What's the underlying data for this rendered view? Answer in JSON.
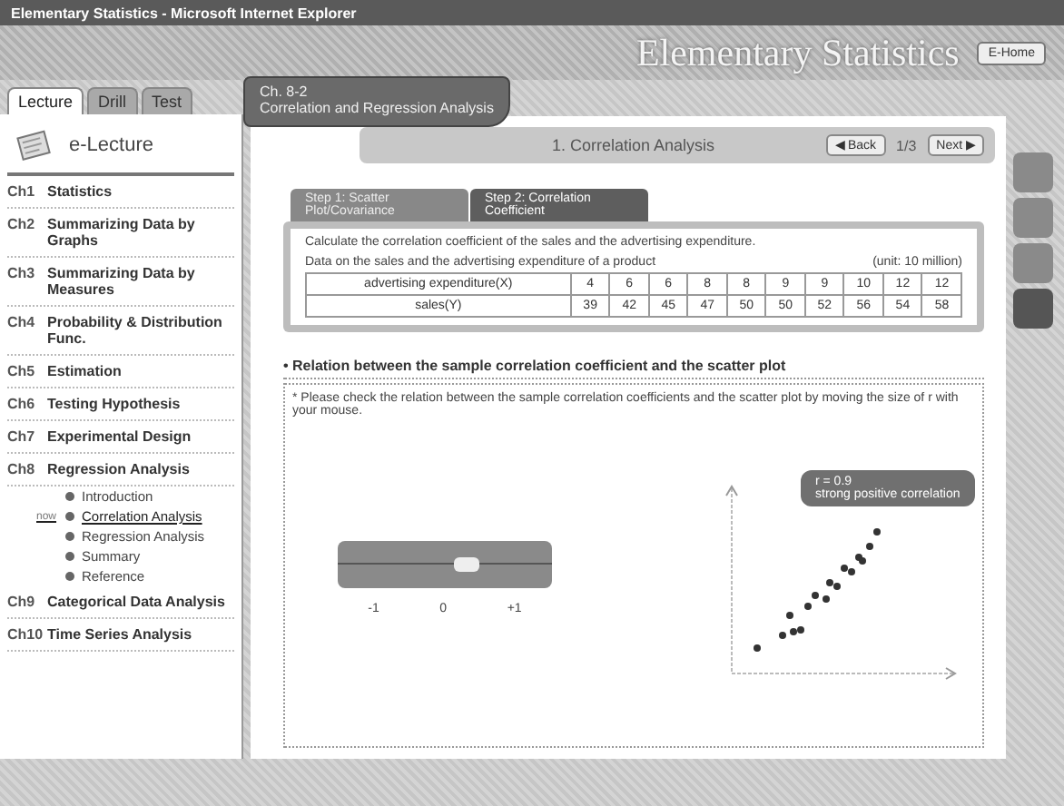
{
  "window": {
    "title": "Elementary Statistics - Microsoft Internet Explorer"
  },
  "header": {
    "title": "Elementary Statistics",
    "home_button": "E-Home"
  },
  "sidebar": {
    "tabs": [
      {
        "label": "Lecture",
        "selected": true
      },
      {
        "label": "Drill",
        "selected": false
      },
      {
        "label": "Test",
        "selected": false
      }
    ],
    "heading": "e-Lecture",
    "items": [
      {
        "number": "Ch1",
        "label": "Statistics"
      },
      {
        "number": "Ch2",
        "label": "Summarizing Data by Graphs"
      },
      {
        "number": "Ch3",
        "label": "Summarizing Data by Measures"
      },
      {
        "number": "Ch4",
        "label": "Probability & Distribution Func."
      },
      {
        "number": "Ch5",
        "label": "Estimation"
      },
      {
        "number": "Ch6",
        "label": "Testing Hypothesis"
      },
      {
        "number": "Ch7",
        "label": "Experimental Design"
      },
      {
        "number": "Ch8",
        "label": "Regression Analysis",
        "children": [
          {
            "label": "Introduction",
            "selected": false
          },
          {
            "label": "Correlation Analysis",
            "selected": true,
            "marker": "now"
          },
          {
            "label": "Regression Analysis",
            "selected": false
          },
          {
            "label": "Summary",
            "selected": false
          },
          {
            "label": "Reference",
            "selected": false
          }
        ]
      },
      {
        "number": "Ch9",
        "label": "Categorical Data Analysis"
      },
      {
        "number": "Ch10",
        "label": "Time Series Analysis"
      }
    ]
  },
  "chapter": {
    "number": "Ch. 8-2",
    "title": "Correlation and Regression Analysis"
  },
  "section_bar": {
    "title": "1. Correlation Analysis",
    "back": "◀ Back",
    "page": "1/3",
    "next": "Next ▶"
  },
  "steps": [
    {
      "label": "Step 1: Scatter Plot/Covariance",
      "selected": false
    },
    {
      "label": "Step 2: Correlation Coefficient",
      "selected": true
    }
  ],
  "exercise": {
    "instruction": "Calculate the correlation coefficient of the sales and the advertising expenditure.",
    "caption": "Data on the sales and the advertising expenditure of a product",
    "unit": "(unit: 10 million)",
    "rows": [
      {
        "label": "advertising expenditure(X)",
        "values": [
          "4",
          "6",
          "6",
          "8",
          "8",
          "9",
          "9",
          "10",
          "12",
          "12"
        ]
      },
      {
        "label": "sales(Y)",
        "values": [
          "39",
          "42",
          "45",
          "47",
          "50",
          "50",
          "52",
          "56",
          "54",
          "58"
        ]
      }
    ]
  },
  "relation": {
    "heading": "• Relation between the sample correlation coefficient and the scatter plot",
    "note": "* Please check the relation between the sample correlation coefficients and the scatter plot by moving the size of r with your mouse.",
    "slider": {
      "level": 0.6,
      "ticks": [
        "-1",
        "0",
        "+1"
      ]
    },
    "callout": {
      "value": "r = 0.9",
      "label": "strong positive correlation"
    }
  }
}
